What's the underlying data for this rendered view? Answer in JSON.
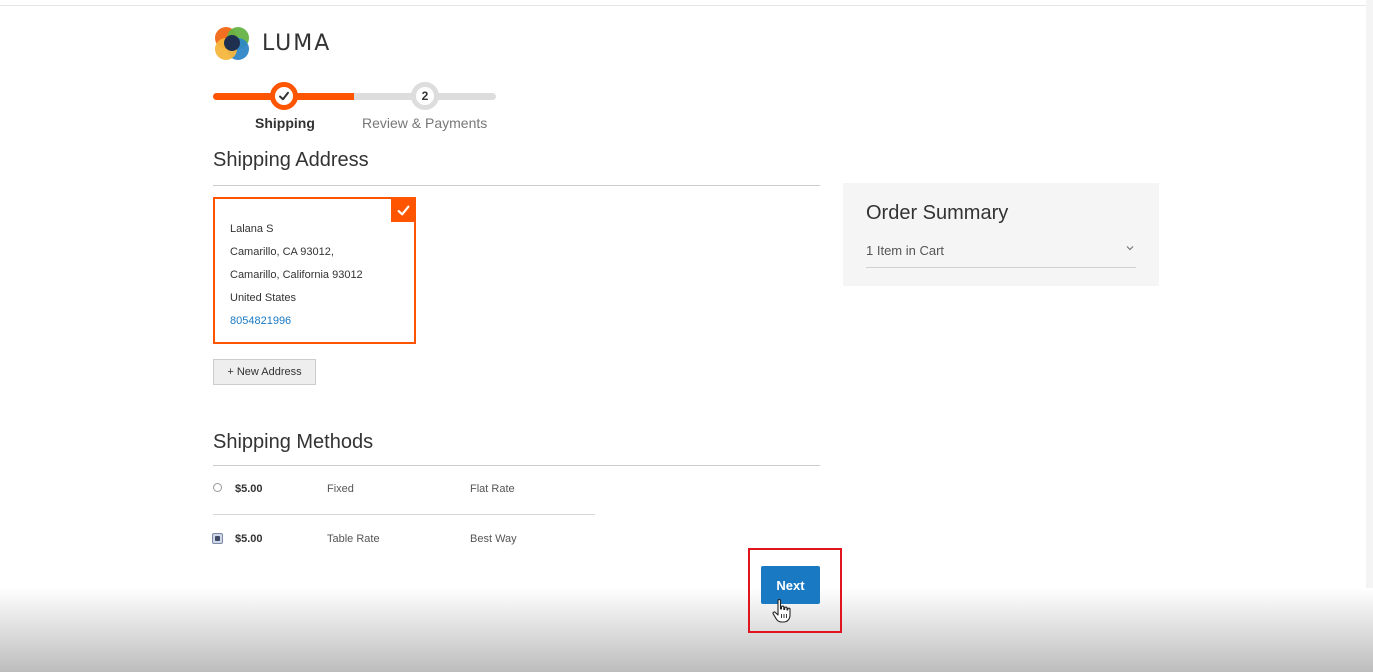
{
  "brand": {
    "name": "LUMA"
  },
  "progress": {
    "steps": [
      {
        "label": "Shipping",
        "state": "complete"
      },
      {
        "number": "2",
        "label": "Review & Payments",
        "state": "upcoming"
      }
    ],
    "completed_fraction": 0.5
  },
  "shipping_address": {
    "title": "Shipping Address",
    "selected_address": {
      "name": "Lalana S",
      "line1": "Camarillo, CA 93012,",
      "line2": "Camarillo, California 93012",
      "country": "United States",
      "phone": "8054821996"
    },
    "new_address_label": "+ New Address"
  },
  "shipping_methods": {
    "title": "Shipping Methods",
    "options": [
      {
        "price": "$5.00",
        "method": "Fixed",
        "carrier": "Flat Rate",
        "selected": false
      },
      {
        "price": "$5.00",
        "method": "Table Rate",
        "carrier": "Best Way",
        "selected": true
      }
    ]
  },
  "actions": {
    "next_label": "Next"
  },
  "order_summary": {
    "title": "Order Summary",
    "items_label": "1 Item in Cart"
  },
  "colors": {
    "accent": "#ff5501",
    "primary_button": "#1979c3",
    "highlight": "#e0161e"
  },
  "icons": {
    "step_complete": "checkmark-icon",
    "selected_card": "checkmark-icon",
    "summary_toggle": "chevron-down-icon",
    "pointer": "hand-cursor-icon"
  }
}
